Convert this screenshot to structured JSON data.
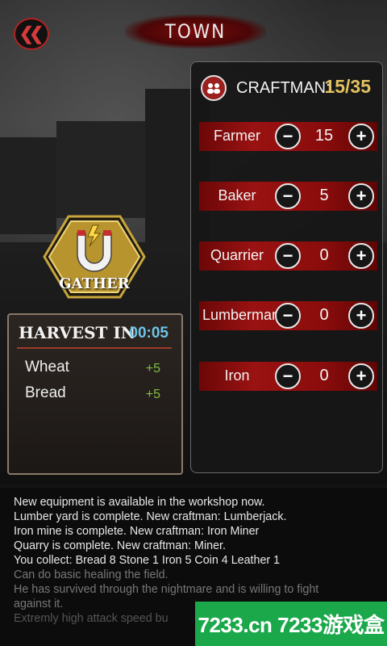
{
  "header": {
    "title": "TOWN",
    "back_icon": "double-chevron-left-icon"
  },
  "craftman": {
    "label": "CRAFTMAN:",
    "count": "15/35",
    "icon": "people-icon"
  },
  "workers": [
    {
      "label": "Farmer",
      "value": "15"
    },
    {
      "label": "Baker",
      "value": "5"
    },
    {
      "label": "Quarrier",
      "value": "0"
    },
    {
      "label": "Lumberman",
      "value": "0"
    },
    {
      "label": "Iron",
      "value": "0"
    }
  ],
  "buttons": {
    "minus": "−",
    "plus": "+"
  },
  "gather": {
    "label": "GATHER",
    "icon": "magnet-icon"
  },
  "harvest": {
    "title": "HARVEST IN",
    "timer": "00:05",
    "items": [
      {
        "name": "Wheat",
        "value": "+5"
      },
      {
        "name": "Bread",
        "value": "+5"
      }
    ]
  },
  "log": [
    "New equipment is available in the workshop now.",
    "Lumber yard is complete. New craftman: Lumberjack.",
    "Iron mine is complete. New craftman: Iron Miner",
    "Quarry is complete. New craftman: Miner.",
    "You collect: Bread 8 Stone 1 Iron 5 Coin 4 Leather 1",
    "Can do basic healing the field.",
    "He has survived through the nightmare and is willing to fight",
    "against it.",
    "Extremly high attack speed bu"
  ],
  "watermark": "7233.cn 7233游戏盒",
  "colors": {
    "accent_red": "#9a1212",
    "count_gold": "#e2c060",
    "timer_blue": "#6ec3e6",
    "gain_green": "#7fbf3f"
  }
}
